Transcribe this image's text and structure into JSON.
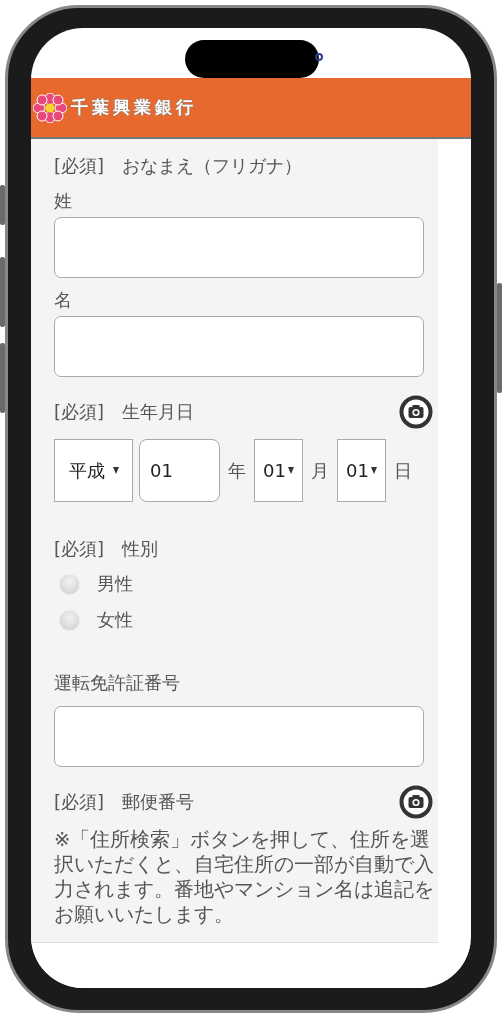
{
  "header": {
    "logo_text": "千葉興業銀行"
  },
  "sections": [
    {
      "kind": "name",
      "required_label": "[必須]",
      "title": "おなまえ（フリガナ）",
      "camera": false,
      "fields": [
        {
          "label": "姓"
        },
        {
          "label": "名"
        }
      ]
    },
    {
      "kind": "date",
      "required_label": "[必須]",
      "title": "生年月日",
      "camera": true,
      "era": "平成",
      "year": "01",
      "year_unit": "年",
      "month": "01",
      "month_unit": "月",
      "day": "01",
      "day_unit": "日"
    },
    {
      "kind": "radio",
      "required_label": "[必須]",
      "title": "性別",
      "camera": false,
      "options": [
        {
          "label": "男性",
          "selected": false
        },
        {
          "label": "女性",
          "selected": false
        }
      ]
    },
    {
      "kind": "text",
      "title": "運転免許証番号",
      "camera": false
    },
    {
      "kind": "note",
      "required_label": "[必須]",
      "title": "郵便番号",
      "camera": true,
      "note": "※「住所検索」ボタンを押して、住所を選択いただくと、自宅住所の一部が自動で入力されます。番地やマンション名は追記をお願いいたします。"
    }
  ]
}
